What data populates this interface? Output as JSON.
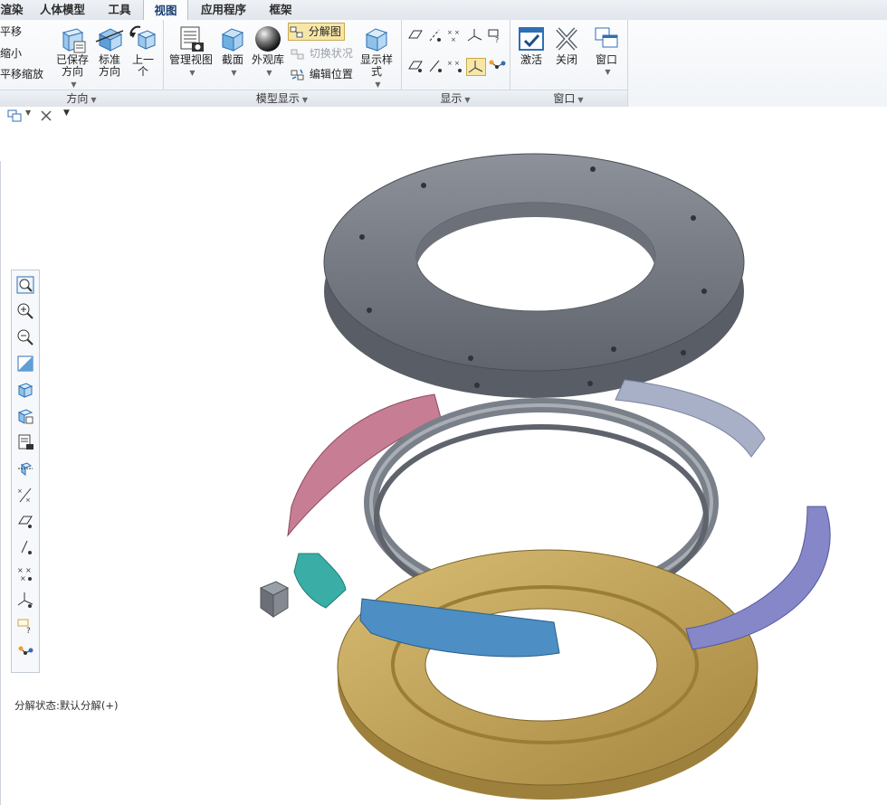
{
  "tabs": [
    {
      "label": "渲染",
      "active": false
    },
    {
      "label": "人体模型",
      "active": false
    },
    {
      "label": "工具",
      "active": false
    },
    {
      "label": "视图",
      "active": true
    },
    {
      "label": "应用程序",
      "active": false
    },
    {
      "label": "框架",
      "active": false
    }
  ],
  "ribbon": {
    "orientation": {
      "group_label": "方向",
      "pan": "平移",
      "zoom_out": "缩小",
      "pan_zoom": "平移缩放",
      "saved_orientation": "已保存\n方向",
      "standard_orientation": "标准\n方向",
      "previous": "上一\n个"
    },
    "model_display": {
      "group_label": "模型显示",
      "manage_views": "管理视图",
      "section": "截面",
      "appearance_gallery": "外观库",
      "exploded_view": "分解图",
      "toggle_status": "切换状况",
      "edit_position": "编辑位置",
      "display_style": "显示样\n式"
    },
    "show": {
      "group_label": "显示"
    },
    "window": {
      "group_label": "窗口",
      "activate": "激活",
      "close": "关闭",
      "window": "窗口"
    }
  },
  "status": {
    "explode_state": "分解状态:默认分解(+)"
  },
  "colors": {
    "accent": "#2f6fb5",
    "gray_plate": "#7b8089",
    "pink_segment": "#c77d93",
    "teal_block": "#3aaea6",
    "blue_segment": "#4d8fc4",
    "purple_segment": "#8587c8",
    "gold_base": "#c4a55b"
  },
  "icons": {
    "vbar": [
      "zoom-fit-icon",
      "zoom-in-icon",
      "zoom-out-icon",
      "refit-icon",
      "view-cube-icon",
      "saved-views-icon",
      "manage-views-icon",
      "spin-center-icon",
      "datum-planes-icon",
      "plane-display-icon",
      "axis-display-icon",
      "point-display-icon",
      "csys-display-icon",
      "annotation-display-icon",
      "explode-icon"
    ]
  }
}
